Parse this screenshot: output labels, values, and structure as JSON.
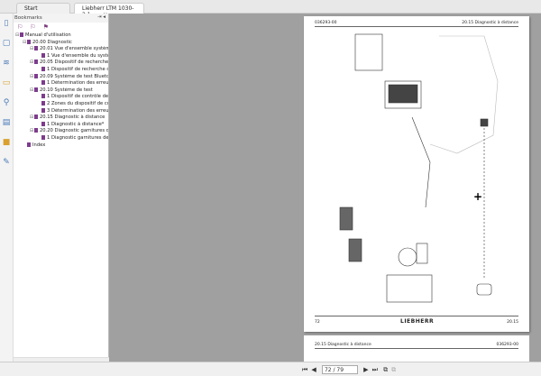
{
  "tabs": [
    {
      "label": "Start"
    },
    {
      "label": "Liebherr LTM 1030-2.1..."
    }
  ],
  "bookmarks": {
    "title": "Bookmarks",
    "items": [
      {
        "label": "Manual d'utilisation",
        "level": 0
      },
      {
        "label": "20.00 Diagnostic",
        "level": 1
      },
      {
        "label": "20.01 Vue d'ensemble système",
        "level": 2
      },
      {
        "label": "1 Vue d'ensemble du systè",
        "level": 3
      },
      {
        "label": "20.05 Dispositif de recherche c",
        "level": 2
      },
      {
        "label": "1 Dispositif de recherche d'",
        "level": 3
      },
      {
        "label": "20.09 Système de test Bluetoo",
        "level": 2
      },
      {
        "label": "1 Détermination des erreurs",
        "level": 3
      },
      {
        "label": "20.10 Système de test",
        "level": 2
      },
      {
        "label": "1 Dispositif de contrôle de l",
        "level": 3
      },
      {
        "label": "2 Zones du dispositif de co",
        "level": 3
      },
      {
        "label": "3 Détermination des erreurs",
        "level": 3
      },
      {
        "label": "20.15 Diagnostic à distance",
        "level": 2
      },
      {
        "label": "1 Diagnostic à distance*",
        "level": 3
      },
      {
        "label": "20.20 Diagnostic garnitures de",
        "level": 2
      },
      {
        "label": "1 Diagnostic garnitures des",
        "level": 3
      },
      {
        "label": "Index",
        "level": 1
      }
    ]
  },
  "document": {
    "page1": {
      "header_left": "036293-00",
      "header_right": "20.15 Diagnostic à distance",
      "footer_left": "72",
      "footer_logo": "LIEBHERR",
      "footer_right": "20.15"
    },
    "page2": {
      "header_left": "20.15 Diagnostic à distance",
      "header_right": "036293-00"
    }
  },
  "navigation": {
    "page_display": "72 / 79"
  }
}
